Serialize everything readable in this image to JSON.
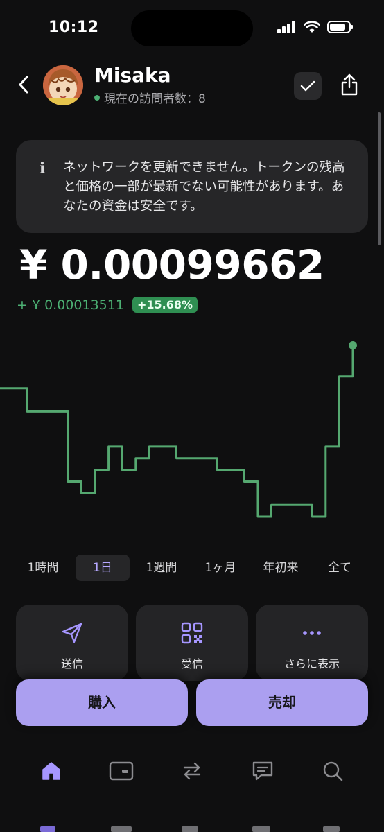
{
  "status_bar": {
    "time": "10:12"
  },
  "header": {
    "wallet_name": "Misaka",
    "visitors_text": "現在の訪問者数：8",
    "online_color": "#4caf73"
  },
  "notice": {
    "icon": "info-icon",
    "text": "ネットワークを更新できません。トークンの残高と価格の一部が最新でない可能性があります。あなたの資金は安全です。"
  },
  "balance": {
    "amount": "¥ 0.00099662",
    "change_amount": "+ ¥ 0.00013511",
    "change_percent": "+15.68%",
    "change_color": "#4caf73"
  },
  "chart_data": {
    "type": "line",
    "title": "",
    "xlabel": "",
    "ylabel": "",
    "grid": false,
    "color": "#55a870",
    "y": [
      0.00096,
      0.00096,
      0.00094,
      0.00094,
      0.00094,
      0.00088,
      0.00087,
      0.00089,
      0.00091,
      0.00089,
      0.0009,
      0.00091,
      0.00091,
      0.0009,
      0.0009,
      0.0009,
      0.00089,
      0.00089,
      0.00088,
      0.00085,
      0.00086,
      0.00086,
      0.00086,
      0.00085,
      0.00091,
      0.00097,
      0.00099662
    ]
  },
  "ranges": [
    "1時間",
    "1日",
    "1週間",
    "1ヶ月",
    "年初来",
    "全て"
  ],
  "active_range": "1日",
  "actions": [
    {
      "label": "送信",
      "icon": "send-icon"
    },
    {
      "label": "受信",
      "icon": "qr-code-icon"
    },
    {
      "label": "さらに表示",
      "icon": "more-icon"
    }
  ],
  "trade": {
    "buy_label": "購入",
    "sell_label": "売却",
    "button_color": "#ab9ff0"
  },
  "tabbar": [
    {
      "icon": "home-icon",
      "active": true
    },
    {
      "icon": "wallet-icon",
      "active": false
    },
    {
      "icon": "swap-icon",
      "active": false
    },
    {
      "icon": "chat-icon",
      "active": false
    },
    {
      "icon": "search-icon",
      "active": false
    }
  ],
  "accent_color": "#9b8cf5"
}
